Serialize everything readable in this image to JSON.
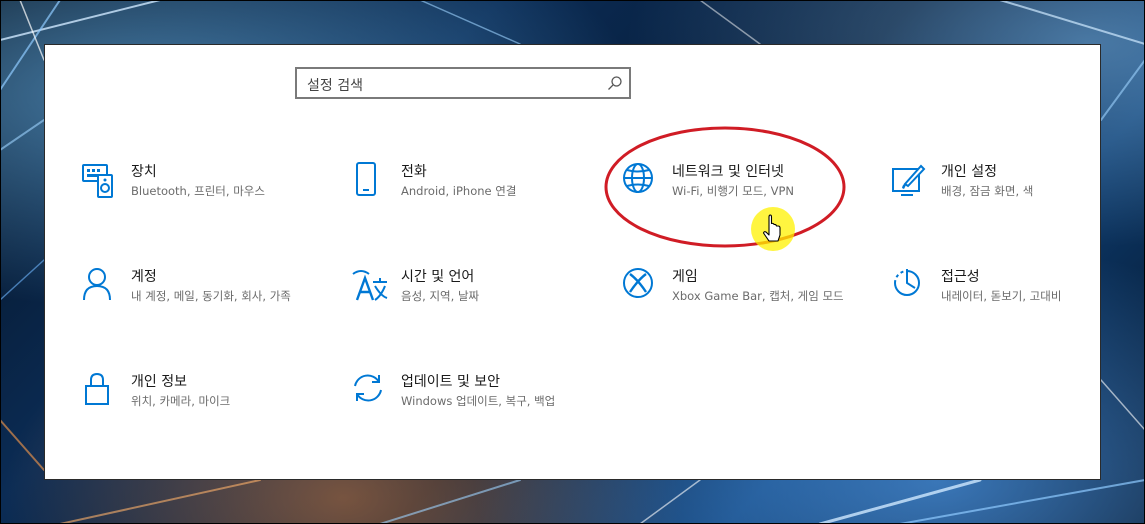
{
  "search": {
    "placeholder": "설정 검색"
  },
  "tiles": [
    {
      "title": "장치",
      "desc": "Bluetooth, 프린터, 마우스",
      "icon": "keyboard-device-icon"
    },
    {
      "title": "전화",
      "desc": "Android, iPhone 연결",
      "icon": "phone-icon"
    },
    {
      "title": "네트워크 및 인터넷",
      "desc": "Wi-Fi, 비행기 모드, VPN",
      "icon": "globe-icon"
    },
    {
      "title": "개인 설정",
      "desc": "배경, 잠금 화면, 색",
      "icon": "paint-brush-icon"
    },
    {
      "title": "계정",
      "desc": "내 계정, 메일, 동기화, 회사, 가족",
      "icon": "person-icon"
    },
    {
      "title": "시간 및 언어",
      "desc": "음성, 지역, 날짜",
      "icon": "time-language-icon"
    },
    {
      "title": "게임",
      "desc": "Xbox Game Bar, 캡처, 게임 모드",
      "icon": "xbox-icon"
    },
    {
      "title": "접근성",
      "desc": "내레이터, 돋보기, 고대비",
      "icon": "ease-of-access-icon"
    },
    {
      "title": "개인 정보",
      "desc": "위치, 카메라, 마이크",
      "icon": "lock-icon"
    },
    {
      "title": "업데이트 및 보안",
      "desc": "Windows 업데이트, 복구, 백업",
      "icon": "update-sync-icon"
    }
  ],
  "colors": {
    "accent": "#0078d4",
    "annotation": "#d01c25",
    "highlight": "#fff200"
  }
}
